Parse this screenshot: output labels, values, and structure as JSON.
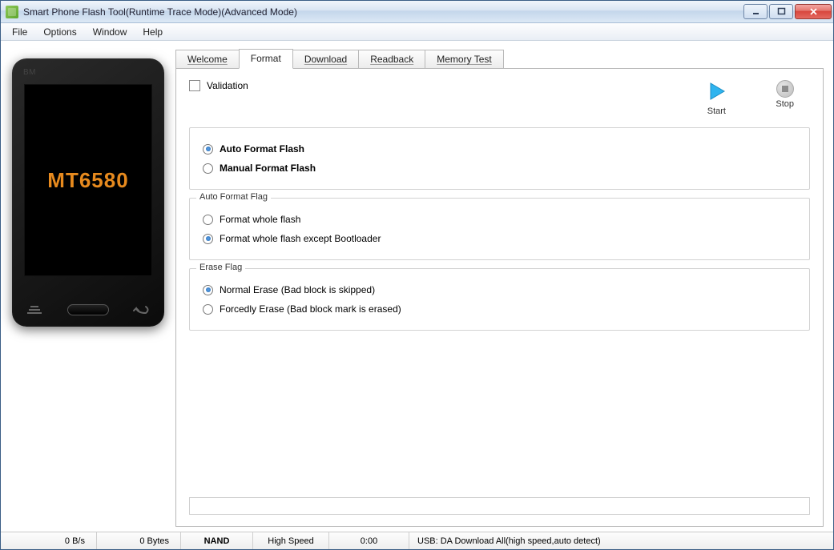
{
  "window": {
    "title": "Smart Phone Flash Tool(Runtime Trace Mode)(Advanced Mode)"
  },
  "menubar": {
    "items": [
      "File",
      "Options",
      "Window",
      "Help"
    ]
  },
  "phone": {
    "brand": "BM",
    "chip": "MT6580"
  },
  "tabs": {
    "items": [
      "Welcome",
      "Format",
      "Download",
      "Readback",
      "Memory Test"
    ],
    "active_index": 1
  },
  "format": {
    "validation_label": "Validation",
    "actions": {
      "start": "Start",
      "stop": "Stop"
    },
    "mode": {
      "auto": "Auto Format Flash",
      "manual": "Manual Format Flash"
    },
    "auto_flag": {
      "title": "Auto Format Flag",
      "whole": "Format whole flash",
      "except_bl": "Format whole flash except Bootloader"
    },
    "erase_flag": {
      "title": "Erase Flag",
      "normal": "Normal Erase (Bad block is skipped)",
      "forcedly": "Forcedly Erase (Bad block mark is erased)"
    }
  },
  "statusbar": {
    "rate": "0 B/s",
    "bytes": "0 Bytes",
    "storage": "NAND",
    "speed": "High Speed",
    "time": "0:00",
    "usb": "USB: DA Download All(high speed,auto detect)"
  }
}
